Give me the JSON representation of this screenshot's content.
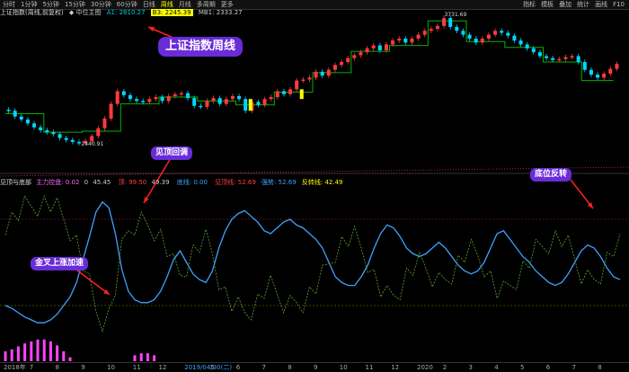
{
  "toolbar": {
    "periods": [
      "分时",
      "1分钟",
      "5分钟",
      "15分钟",
      "30分钟",
      "60分钟",
      "日线",
      "周线",
      "月线",
      "多周期",
      "更多"
    ],
    "right_items": [
      "指标",
      "模板",
      "叠加",
      "统计",
      "画线",
      "F10"
    ]
  },
  "info": {
    "index_name": "上证指数(周线,前复权)",
    "main_chart": "◆ 中位主图",
    "a1": "A1: 2810.27",
    "b3": "B3: 2245.39",
    "mb1": "MB1: 2333.27"
  },
  "indicator_info": {
    "name": "见顶与底部",
    "main_force": "主力控盘: 0.02",
    "v1": "0",
    "v2": "45.45",
    "red_label": "顶: 99.50",
    "v3": "49.39",
    "blue_label": "底线: 0.00",
    "signals": "见顶线: 52.69",
    "trend": "强势: 52.69",
    "reversal": "反转线: 42.49"
  },
  "annotations": {
    "title_box": "上证指数周线",
    "top_signal": "见顶回调",
    "bottom_signal": "底位反转",
    "golden_cross": "金叉上涨加速"
  },
  "price_labels": {
    "high": "3731.69",
    "low": "2440.91"
  },
  "dates": [
    "2018年",
    "7",
    "8",
    "9",
    "10",
    "11",
    "12",
    "2019/04/30(二)",
    "5",
    "6",
    "7",
    "8",
    "9",
    "10",
    "11",
    "12",
    "2020",
    "2",
    "3",
    "4",
    "5",
    "6",
    "7",
    "8"
  ],
  "colors": {
    "up": "#ff3b3b",
    "down": "#00d8ff",
    "ma_green": "#00b400",
    "osc_blue": "#3da2ff",
    "osc_green": "#5fa832",
    "yellow": "#ffff00",
    "magenta": "#ff44ff",
    "callout_purple": "#6a2bd9"
  },
  "chart_data": {
    "type": "candlestick",
    "title": "上证指数周线",
    "y_label_high": 3731.69,
    "y_label_low": 2440.91,
    "closes": [
      2780,
      2720,
      2690,
      2650,
      2610,
      2580,
      2560,
      2540,
      2500,
      2480,
      2460,
      2445,
      2470,
      2520,
      2600,
      2700,
      2850,
      2980,
      2940,
      2900,
      2880,
      2870,
      2900,
      2920,
      2880,
      2930,
      2950,
      2960,
      2910,
      2830,
      2820,
      2880,
      2910,
      2850,
      2900,
      2930,
      2900,
      2780,
      2870,
      2840,
      2900,
      2920,
      2980,
      2950,
      3000,
      3090,
      3100,
      3120,
      3180,
      3140,
      3200,
      3250,
      3280,
      3320,
      3350,
      3380,
      3420,
      3450,
      3400,
      3460,
      3500,
      3520,
      3480,
      3520,
      3560,
      3600,
      3620,
      3650,
      3731,
      3640,
      3600,
      3560,
      3520,
      3480,
      3520,
      3560,
      3600,
      3580,
      3550,
      3500,
      3460,
      3420,
      3380,
      3340,
      3320,
      3300,
      3310,
      3330,
      3340,
      3280,
      3200,
      3150,
      3120,
      3160,
      3210,
      3260
    ],
    "oscillator_blue": [
      20,
      18,
      15,
      12,
      10,
      8,
      8,
      10,
      14,
      20,
      26,
      36,
      52,
      68,
      85,
      92,
      88,
      70,
      45,
      30,
      24,
      22,
      22,
      24,
      30,
      40,
      52,
      58,
      50,
      42,
      38,
      36,
      44,
      60,
      72,
      80,
      84,
      86,
      82,
      78,
      72,
      70,
      74,
      78,
      80,
      76,
      74,
      70,
      66,
      60,
      50,
      40,
      36,
      34,
      34,
      40,
      48,
      60,
      70,
      76,
      74,
      68,
      60,
      56,
      54,
      56,
      60,
      64,
      60,
      54,
      48,
      44,
      42,
      44,
      50,
      60,
      70,
      72,
      66,
      60,
      54,
      50,
      44,
      40,
      36,
      34,
      36,
      42,
      50,
      58,
      62,
      60,
      54,
      46,
      40,
      38
    ]
  }
}
